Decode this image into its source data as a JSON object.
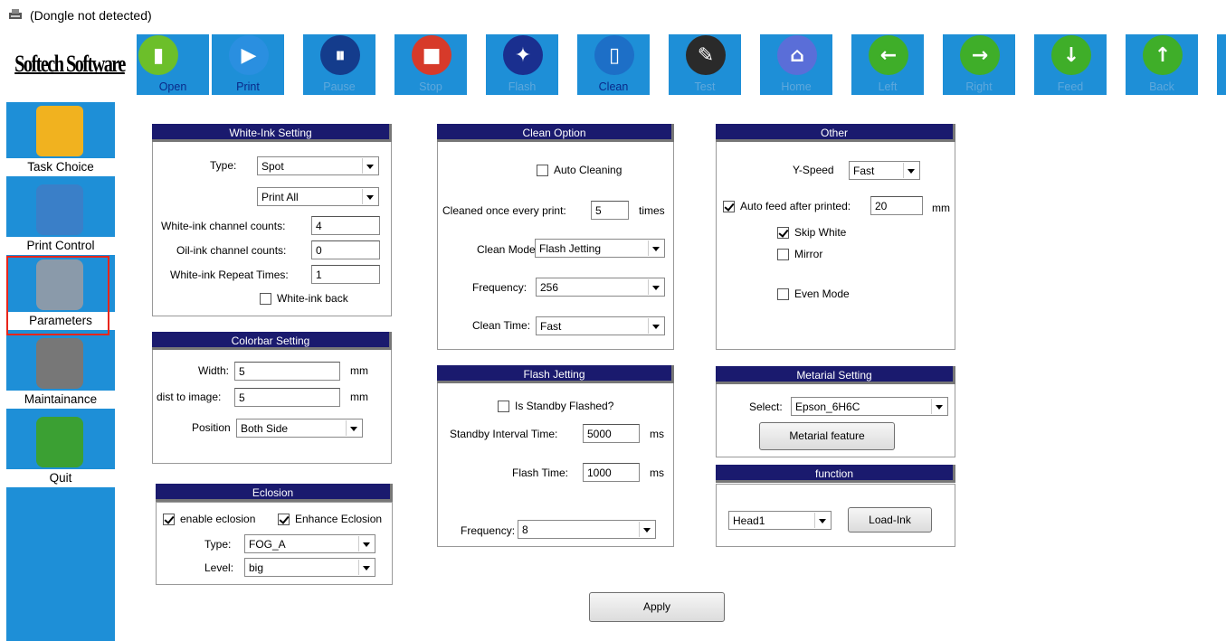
{
  "title_bar": {
    "text": "(Dongle not detected)"
  },
  "logo_text": "Softech Software",
  "toolbar": [
    {
      "label": "Open",
      "active": true,
      "color": "#6cbf2a",
      "glyph": "▮"
    },
    {
      "label": "Print",
      "active": true,
      "color": "#2a8fe0",
      "glyph": "▶"
    },
    {
      "label": "Pause",
      "active": false,
      "color": "#143c8c",
      "glyph": "⏸"
    },
    {
      "label": "Stop",
      "active": false,
      "color": "#d73a2a",
      "glyph": "■"
    },
    {
      "label": "Flash",
      "active": false,
      "color": "#1a2f8f",
      "glyph": "✦"
    },
    {
      "label": "Clean",
      "active": true,
      "color": "#1d6fc7",
      "glyph": "▯"
    },
    {
      "label": "Test",
      "active": false,
      "color": "#2a2a2a",
      "glyph": "✎"
    },
    {
      "label": "Home",
      "active": false,
      "color": "#5a6ed8",
      "glyph": "⌂"
    },
    {
      "label": "Left",
      "active": false,
      "color": "#3fae29",
      "glyph": "←"
    },
    {
      "label": "Right",
      "active": false,
      "color": "#3fae29",
      "glyph": "→"
    },
    {
      "label": "Feed",
      "active": false,
      "color": "#3fae29",
      "glyph": "↓"
    },
    {
      "label": "Back",
      "active": false,
      "color": "#3fae29",
      "glyph": "↑"
    }
  ],
  "sidebar": [
    {
      "label": "Task Choice",
      "icon": "folder-icon"
    },
    {
      "label": "Print Control",
      "icon": "disc-icon"
    },
    {
      "label": "Parameters",
      "icon": "gears-icon"
    },
    {
      "label": "Maintainance",
      "icon": "tools-icon"
    },
    {
      "label": "Quit",
      "icon": "exit-icon"
    }
  ],
  "white_ink": {
    "title": "White-Ink Setting",
    "type_label": "Type:",
    "type_value": "Spot",
    "mode_value": "Print All",
    "channel_label": "White-ink channel counts:",
    "channel_value": "4",
    "oil_label": "Oil-ink channel counts:",
    "oil_value": "0",
    "repeat_label": "White-ink Repeat Times:",
    "repeat_value": "1",
    "back_label": "White-ink back"
  },
  "colorbar": {
    "title": "Colorbar Setting",
    "width_label": "Width:",
    "width_value": "5",
    "width_unit": "mm",
    "dist_label": "dist to image:",
    "dist_value": "5",
    "dist_unit": "mm",
    "position_label": "Position",
    "position_value": "Both Side"
  },
  "eclosion": {
    "title": "Eclosion",
    "enable_label": "enable eclosion",
    "enhance_label": "Enhance Eclosion",
    "type_label": "Type:",
    "type_value": "FOG_A",
    "level_label": "Level:",
    "level_value": "big"
  },
  "clean": {
    "title": "Clean Option",
    "auto_label": "Auto Cleaning",
    "every_label": "Cleaned once every print:",
    "every_value": "5",
    "every_unit": "times",
    "mode_label": "Clean Mode:",
    "mode_value": "Flash Jetting",
    "freq_label": "Frequency:",
    "freq_value": "256",
    "time_label": "Clean Time:",
    "time_value": "Fast"
  },
  "flash": {
    "title": "Flash Jetting",
    "standby_label": "Is Standby Flashed?",
    "interval_label": "Standby Interval Time:",
    "interval_value": "5000",
    "interval_unit": "ms",
    "time_label": "Flash Time:",
    "time_value": "1000",
    "time_unit": "ms",
    "freq_label": "Frequency:",
    "freq_value": "8"
  },
  "other": {
    "title": "Other",
    "yspeed_label": "Y-Speed",
    "yspeed_value": "Fast",
    "autofeed_label": "Auto feed after printed:",
    "autofeed_value": "20",
    "autofeed_unit": "mm",
    "skip_label": "Skip White",
    "mirror_label": "Mirror",
    "even_label": "Even Mode"
  },
  "material": {
    "title": "Metarial Setting",
    "select_label": "Select:",
    "select_value": "Epson_6H6C",
    "feature_button": "Metarial feature"
  },
  "function": {
    "title": "function",
    "head_value": "Head1",
    "load_button": "Load-Ink"
  },
  "apply_button": "Apply"
}
